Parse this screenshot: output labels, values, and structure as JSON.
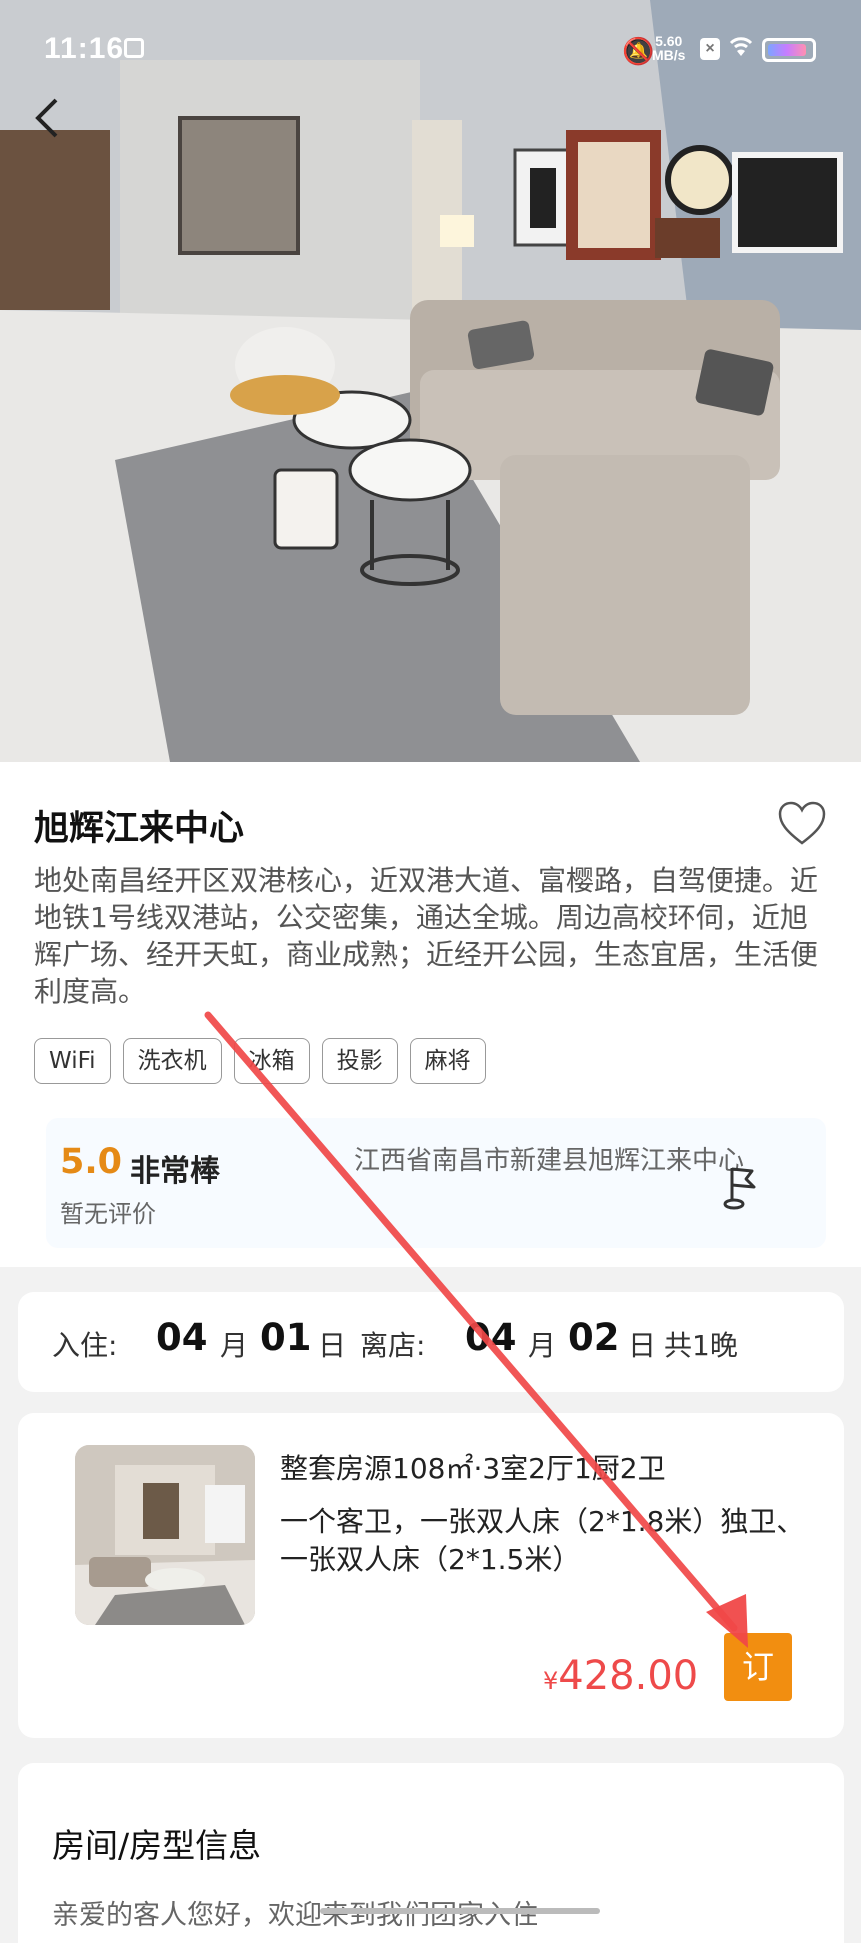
{
  "status_bar": {
    "time": "11:16",
    "net_speed_value": "5.60",
    "net_speed_unit": "MB/s"
  },
  "icons": {
    "back": "chevron-left-icon",
    "favorite": "heart-icon",
    "map": "map-flag-icon",
    "wifi": "wifi-icon",
    "mute": "bell-mute-icon"
  },
  "listing": {
    "title": "旭辉江来中心",
    "description": "地处南昌经开区双港核心，近双港大道、富樱路，自驾便捷。近地铁1号线双港站，公交密集，通达全城。周边高校环伺，近旭辉广场、经开天虹，商业成熟；近经开公园，生态宜居，生活便利度高。",
    "amenities": [
      "WiFi",
      "洗衣机",
      "冰箱",
      "投影",
      "麻将"
    ],
    "rating": {
      "score": "5.0",
      "word": "非常棒",
      "reviews": "暂无评价"
    },
    "address": "江西省南昌市新建县旭辉江来中心"
  },
  "booking": {
    "checkin_label": "入住:",
    "checkin_month": "04",
    "month_unit": "月",
    "checkin_day": "01",
    "day_unit": "日",
    "checkout_label": "离店:",
    "checkout_month": "04",
    "checkout_day": "02",
    "nights": "共1晚"
  },
  "room": {
    "title": "整套房源108㎡·3室2厅1厨2卫",
    "beds": "一个客卫，一张双人床（2*1.8米）独卫、一张双人床（2*1.5米）",
    "currency": "¥",
    "price": "428.00",
    "book_label": "订"
  },
  "room_info": {
    "title": "房间/房型信息",
    "greeting": "亲爱的客人您好，欢迎来到我们团家入住"
  },
  "colors": {
    "accent_orange": "#f28e10",
    "price_red": "#ee4a4a",
    "rating_orange": "#e58a16",
    "annotation_arrow": "#f04848"
  }
}
